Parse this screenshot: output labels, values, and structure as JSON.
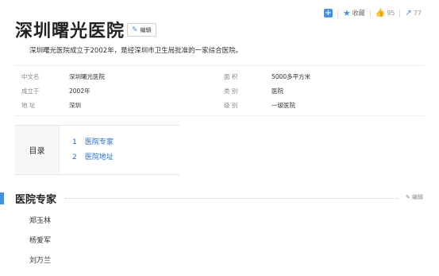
{
  "toolbar": {
    "plus": "+",
    "collect_label": "收藏",
    "like_count": "95",
    "share_count": "77"
  },
  "page": {
    "title": "深圳曙光医院",
    "edit_label": "编辑",
    "summary": "深圳曙光医院成立于2002年，是经深圳市卫生局批准的一家综合医院。"
  },
  "info": [
    {
      "k": "中文名",
      "v": "深圳曙光医院",
      "k2": "面    积",
      "v2": "5000多平方米"
    },
    {
      "k": "成立于",
      "v": "2002年",
      "k2": "类    别",
      "v2": "医院"
    },
    {
      "k": "地    址",
      "v": "深圳",
      "k2": "级    别",
      "v2": "一级医院"
    }
  ],
  "toc": {
    "heading": "目录",
    "items": [
      {
        "num": "1",
        "label": "医院专家"
      },
      {
        "num": "2",
        "label": "医院地址"
      }
    ]
  },
  "section": {
    "title": "医院专家",
    "edit_label": "编辑"
  },
  "experts": [
    "郑玉林",
    "杨爱军",
    "刘万兰"
  ],
  "colors": {
    "accent": "#4a90d9",
    "link": "#2a6dbf"
  }
}
